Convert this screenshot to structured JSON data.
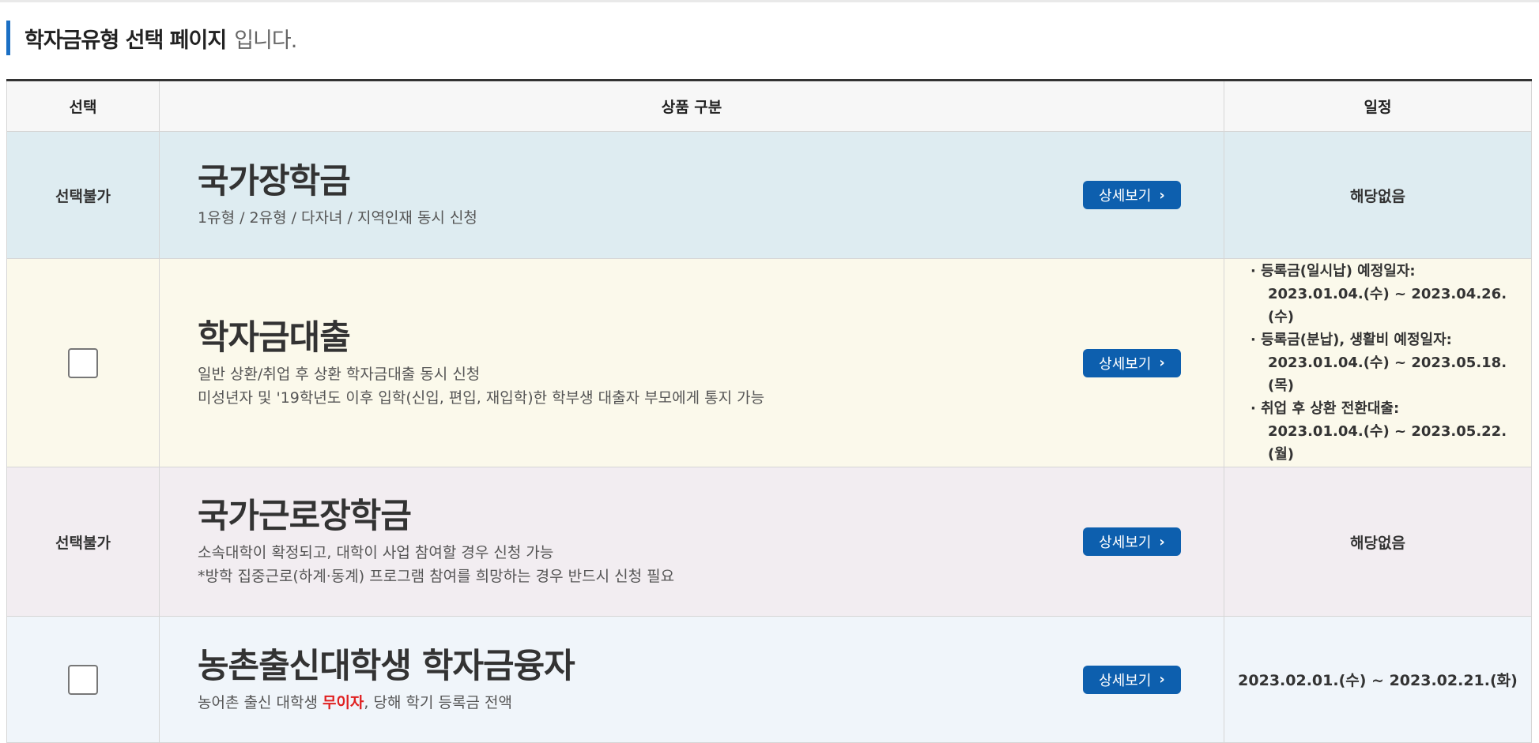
{
  "heading": {
    "strong": "학자금유형 선택 페이지",
    "light": "입니다."
  },
  "table": {
    "headers": [
      "선택",
      "상품 구분",
      "일정"
    ],
    "rows": [
      {
        "select_text": "선택불가",
        "name": "국가장학금",
        "desc": [
          "1유형 / 2유형 / 다자녀 / 지역인재 동시 신청"
        ],
        "detail_label": "상세보기",
        "schedule_text": "해당없음"
      },
      {
        "select_checkbox": true,
        "name": "학자금대출",
        "desc": [
          "일반 상환/취업 후 상환 학자금대출 동시 신청",
          "미성년자 및 '19학년도 이후 입학(신입, 편입, 재입학)한 학부생 대출자 부모에게 통지 가능"
        ],
        "detail_label": "상세보기",
        "schedule_lines": [
          "· 등록금(일시납) 예정일자:",
          "2023.01.04.(수) ~ 2023.04.26.(수)",
          "· 등록금(분납), 생활비 예정일자:",
          "2023.01.04.(수) ~ 2023.05.18.(목)",
          "· 취업 후 상환 전환대출:",
          "2023.01.04.(수) ~ 2023.05.22.(월)"
        ]
      },
      {
        "select_text": "선택불가",
        "name": "국가근로장학금",
        "desc": [
          "소속대학이 확정되고, 대학이 사업 참여할 경우 신청 가능",
          "*방학 집중근로(하계·동계) 프로그램 참여를 희망하는 경우 반드시 신청 필요"
        ],
        "detail_label": "상세보기",
        "schedule_text": "해당없음"
      },
      {
        "select_checkbox": true,
        "name": "농촌출신대학생 학자금융자",
        "desc_prefix": "농어촌 출신 대학생 ",
        "desc_highlight": "무이자",
        "desc_suffix": ", 당해 학기 등록금 전액",
        "detail_label": "상세보기",
        "schedule_text": "2023.02.01.(수) ~ 2023.02.21.(화)"
      }
    ]
  },
  "icons": {
    "detail_arrow": "chevron-right-icon"
  },
  "colors": {
    "accent_blue": "#0d5fae",
    "heading_bar": "#1b6fc4",
    "highlight_red": "#e02020"
  }
}
